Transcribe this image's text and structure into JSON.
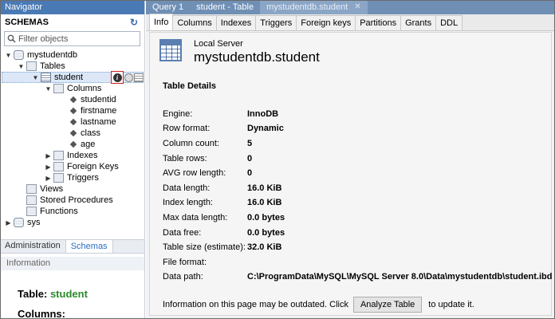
{
  "navigator": {
    "title": "Navigator",
    "schemas_label": "SCHEMAS",
    "filter_placeholder": "Filter objects",
    "tree": {
      "db": "mystudentdb",
      "tables": "Tables",
      "table": "student",
      "columns_folder": "Columns",
      "columns": [
        "studentid",
        "firstname",
        "lastname",
        "class",
        "age"
      ],
      "indexes": "Indexes",
      "foreign_keys": "Foreign Keys",
      "triggers": "Triggers",
      "views": "Views",
      "stored_procedures": "Stored Procedures",
      "functions": "Functions",
      "sys": "sys"
    },
    "bottom_tabs": [
      "Administration",
      "Schemas"
    ],
    "info_header": "Information",
    "info_table_label": "Table:",
    "info_table_name": "student",
    "info_columns_label": "Columns:"
  },
  "doc_tabs": [
    "Query 1",
    "student - Table",
    "mystudentdb.student"
  ],
  "sub_tabs": [
    "Info",
    "Columns",
    "Indexes",
    "Triggers",
    "Foreign keys",
    "Partitions",
    "Grants",
    "DDL"
  ],
  "header": {
    "server": "Local Server",
    "table_name": "mystudentdb.student"
  },
  "table_details_title": "Table Details",
  "details": [
    {
      "label": "Engine:",
      "value": "InnoDB"
    },
    {
      "label": "Row format:",
      "value": "Dynamic"
    },
    {
      "label": "Column count:",
      "value": "5"
    },
    {
      "label": "Table rows:",
      "value": "0"
    },
    {
      "label": "AVG row length:",
      "value": "0"
    },
    {
      "label": "Data length:",
      "value": "16.0 KiB"
    },
    {
      "label": "Index length:",
      "value": "16.0 KiB"
    },
    {
      "label": "Max data length:",
      "value": "0.0 bytes"
    },
    {
      "label": "Data free:",
      "value": "0.0 bytes"
    },
    {
      "label": "Table size (estimate):",
      "value": "32.0 KiB"
    },
    {
      "label": "File format:",
      "value": ""
    },
    {
      "label": "Data path:",
      "value": "C:\\ProgramData\\MySQL\\MySQL Server 8.0\\Data\\mystudentdb\\student.ibd"
    }
  ],
  "footer": {
    "text_before": "Information on this page may be outdated. Click",
    "button": "Analyze Table",
    "text_after": "to update it."
  },
  "colors": {
    "accent": "#4a7ab5",
    "tab_bar": "#6f8fb5",
    "green_name": "#2a8a2a",
    "highlight_border": "#d21f1f"
  }
}
